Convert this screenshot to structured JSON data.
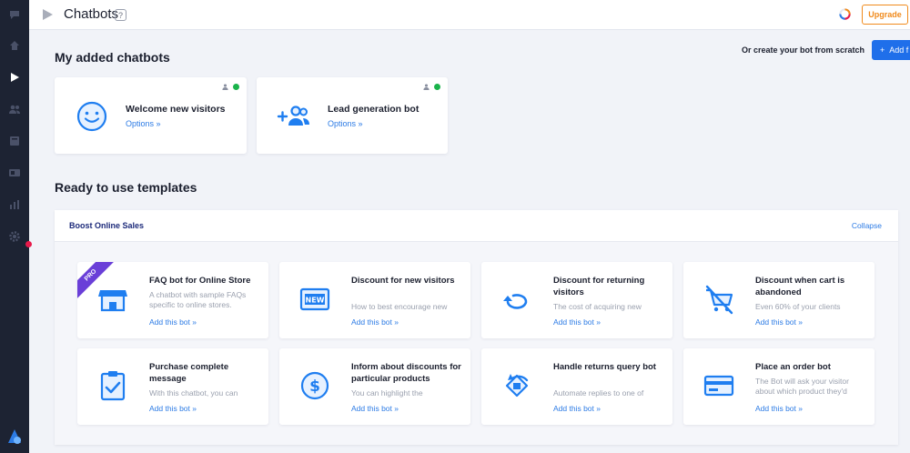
{
  "topbar": {
    "title": "Chatbots",
    "help": "?",
    "upgrade_label": "Upgrade"
  },
  "added": {
    "heading": "My added chatbots",
    "scratch_text": "Or create your bot from scratch",
    "add_button_label": "Add f",
    "bots": [
      {
        "name": "Welcome new visitors",
        "options": "Options »",
        "icon": "smiley-icon"
      },
      {
        "name": "Lead generation bot",
        "options": "Options »",
        "icon": "add-users-icon"
      }
    ]
  },
  "templates": {
    "heading": "Ready to use templates",
    "group_title": "Boost Online Sales",
    "collapse_label": "Collapse",
    "pro_label": "PRO",
    "cards": [
      {
        "title": "FAQ bot for Online Store",
        "desc": "A chatbot with sample FAQs specific to online stores.",
        "add": "Add this bot »",
        "icon": "store-icon"
      },
      {
        "title": "Discount for new visitors",
        "desc": "How to best encourage new",
        "add": "Add this bot »",
        "icon": "new-badge-icon"
      },
      {
        "title": "Discount for returning visitors",
        "desc": "The cost of acquiring new",
        "add": "Add this bot »",
        "icon": "return-arrow-icon"
      },
      {
        "title": "Discount when cart is abandoned",
        "desc": "Even 60% of your clients",
        "add": "Add this bot »",
        "icon": "cart-crossed-icon"
      },
      {
        "title": "Purchase complete message",
        "desc": "With this chatbot, you can",
        "add": "Add this bot »",
        "icon": "clipboard-check-icon"
      },
      {
        "title": "Inform about discounts for particular products",
        "desc": "You can highlight the",
        "add": "Add this bot »",
        "icon": "dollar-coin-icon"
      },
      {
        "title": "Handle returns query bot",
        "desc": "Automate replies to one of",
        "add": "Add this bot »",
        "icon": "return-box-icon"
      },
      {
        "title": "Place an order bot",
        "desc": "The Bot will ask your visitor about which product they'd",
        "add": "Add this bot »",
        "icon": "credit-card-icon"
      }
    ]
  },
  "colors": {
    "accent": "#2c7be5",
    "sidebar": "#1d2333",
    "upgrade": "#f08a1c",
    "online": "#1ab34b",
    "pro": "#6a3fd8"
  }
}
